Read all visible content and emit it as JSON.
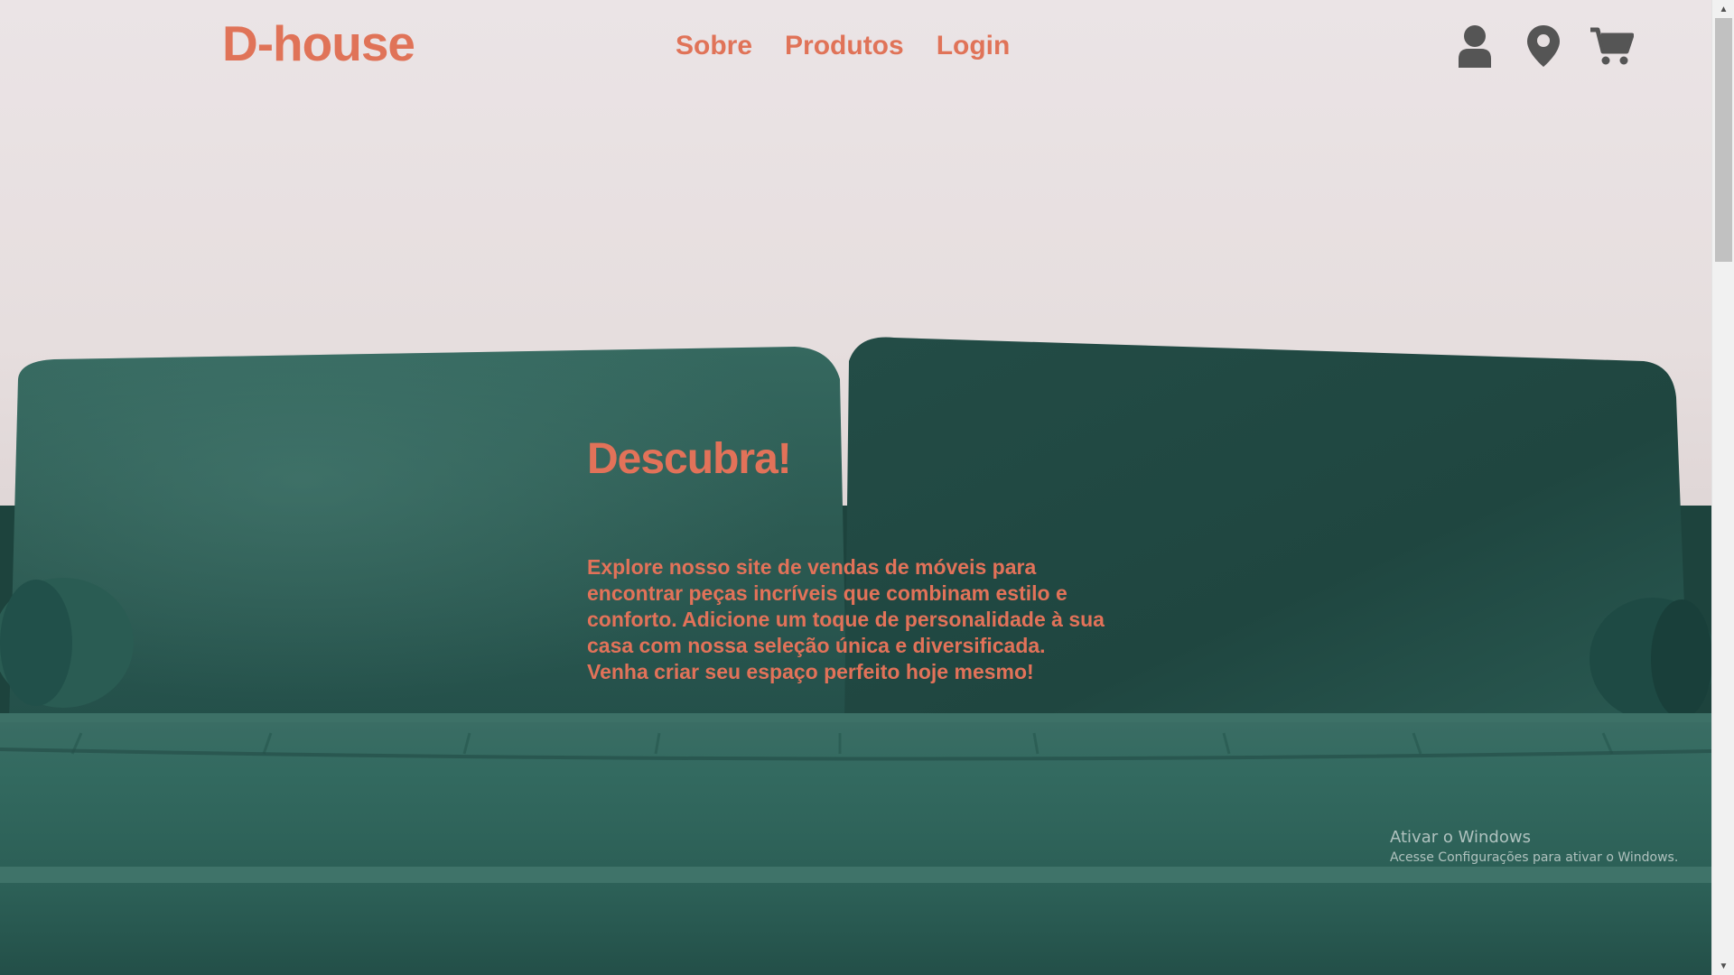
{
  "brand": {
    "logo": "D-house",
    "accent_color": "#e07358"
  },
  "nav": {
    "items": [
      {
        "label": "Sobre"
      },
      {
        "label": "Produtos"
      },
      {
        "label": "Login"
      }
    ]
  },
  "header_icons": [
    {
      "name": "user-icon"
    },
    {
      "name": "map-pin-icon"
    },
    {
      "name": "cart-icon"
    }
  ],
  "hero": {
    "title": "Descubra!",
    "text": "Explore nosso site de vendas de móveis para encontrar peças incríveis que combinam estilo e conforto. Adicione um toque de personalidade à sua casa com nossa seleção única e diversificada. Venha criar seu espaço perfeito hoje mesmo!",
    "background": "green-velvet-sofa-photo",
    "sofa_color": "#2e5d55"
  },
  "watermark": {
    "title": "Ativar o Windows",
    "subtitle": "Acesse Configurações para ativar o Windows."
  }
}
